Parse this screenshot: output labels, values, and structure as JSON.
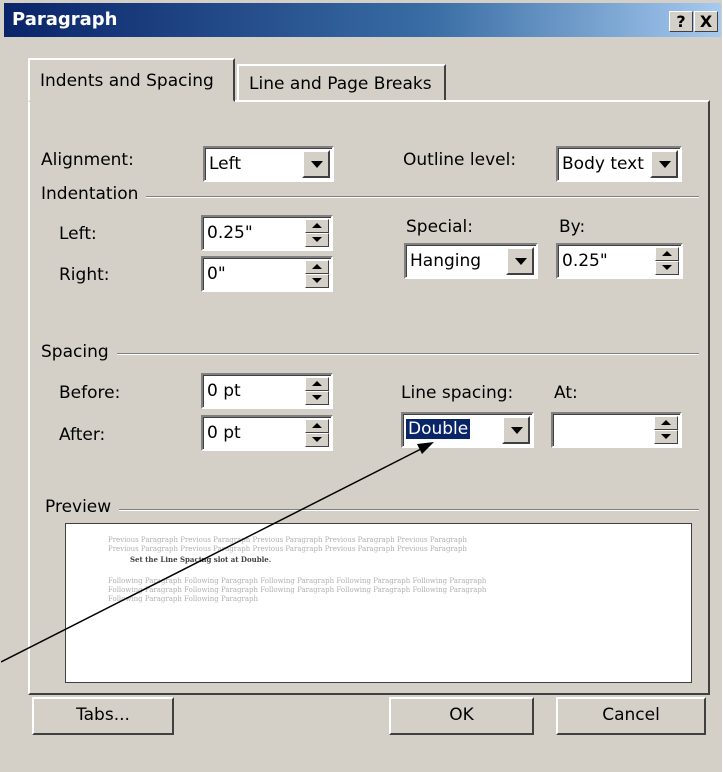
{
  "window": {
    "title": "Paragraph",
    "help_label": "?",
    "close_label": "X"
  },
  "tabs": [
    {
      "label": "Indents and Spacing"
    },
    {
      "label": "Line and Page Breaks"
    }
  ],
  "general": {
    "alignment_label": "Alignment:",
    "alignment_value": "Left",
    "outline_label": "Outline level:",
    "outline_value": "Body text"
  },
  "indentation": {
    "header": "Indentation",
    "left_label": "Left:",
    "left_value": "0.25\"",
    "right_label": "Right:",
    "right_value": "0\"",
    "special_label": "Special:",
    "special_value": "Hanging",
    "by_label": "By:",
    "by_value": "0.25\""
  },
  "spacing": {
    "header": "Spacing",
    "before_label": "Before:",
    "before_value": "0 pt",
    "after_label": "After:",
    "after_value": "0 pt",
    "line_spacing_label": "Line spacing:",
    "line_spacing_value": "Double",
    "at_label": "At:",
    "at_value": ""
  },
  "preview": {
    "header": "Preview",
    "prev1": "Previous Paragraph Previous Paragraph Previous Paragraph Previous Paragraph Previous Paragraph",
    "prev2": "Previous Paragraph Previous Paragraph Previous Paragraph Previous Paragraph Previous Paragraph",
    "current": "Set the Line Spacing slot at Double.",
    "fol1": "Following Paragraph Following Paragraph Following Paragraph Following Paragraph Following Paragraph",
    "fol2": "Following Paragraph Following Paragraph Following Paragraph Following Paragraph Following Paragraph",
    "fol3": "Following Paragraph Following Paragraph"
  },
  "buttons": {
    "tabs": "Tabs...",
    "ok": "OK",
    "cancel": "Cancel"
  },
  "colors": {
    "titlebar": "#0a246a",
    "face": "#d4d0c8",
    "selection": "#0a246a"
  }
}
